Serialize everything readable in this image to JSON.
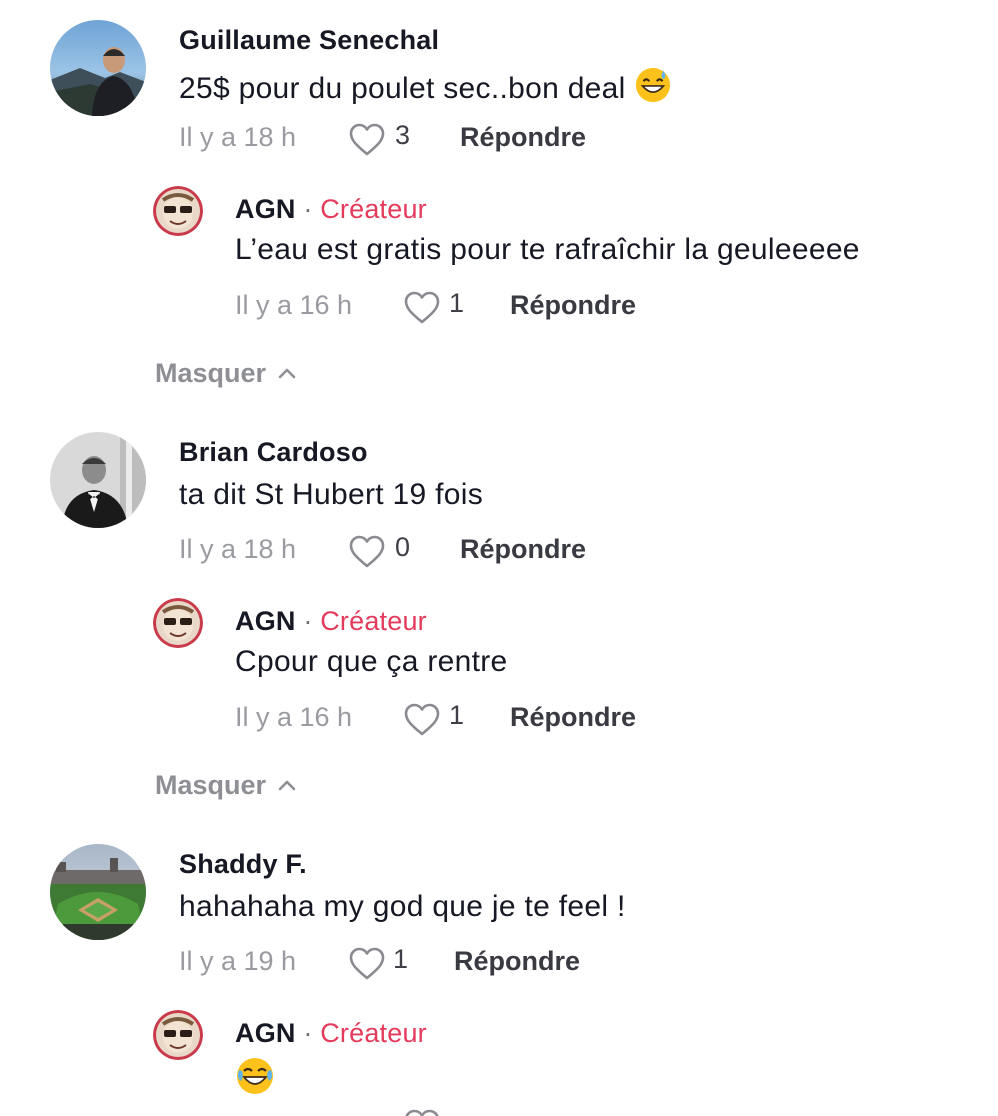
{
  "threads": [
    {
      "author": "Guillaume Senechal",
      "text": "25$ pour du poulet sec..bon deal",
      "time": "Il y a 18 h",
      "likes": "3",
      "reply_label": "Répondre",
      "reply": {
        "author": "AGN",
        "separator": "·",
        "badge": "Créateur",
        "text": "L’eau est gratis pour te rafraîchir la geuleeeee",
        "time": "Il y a 16 h",
        "likes": "1",
        "reply_label": "Répondre"
      },
      "hide_label": "Masquer"
    },
    {
      "author": "Brian Cardoso",
      "text": "ta dit St Hubert 19 fois",
      "time": "Il y a 18 h",
      "likes": "0",
      "reply_label": "Répondre",
      "reply": {
        "author": "AGN",
        "separator": "·",
        "badge": "Créateur",
        "text": "Cpour que ça rentre",
        "time": "Il y a 16 h",
        "likes": "1",
        "reply_label": "Répondre"
      },
      "hide_label": "Masquer"
    },
    {
      "author": "Shaddy F.",
      "text": "hahahaha my god que je te feel !",
      "time": "Il y a 19 h",
      "likes": "1",
      "reply_label": "Répondre",
      "reply": {
        "author": "AGN",
        "separator": "·",
        "badge": "Créateur",
        "text": "",
        "emoji": "face-with-tears-of-joy-emoji"
      }
    }
  ],
  "colors": {
    "creator_badge": "#e33b5c",
    "meta_text": "#9a9ba0",
    "text": "#161823"
  }
}
